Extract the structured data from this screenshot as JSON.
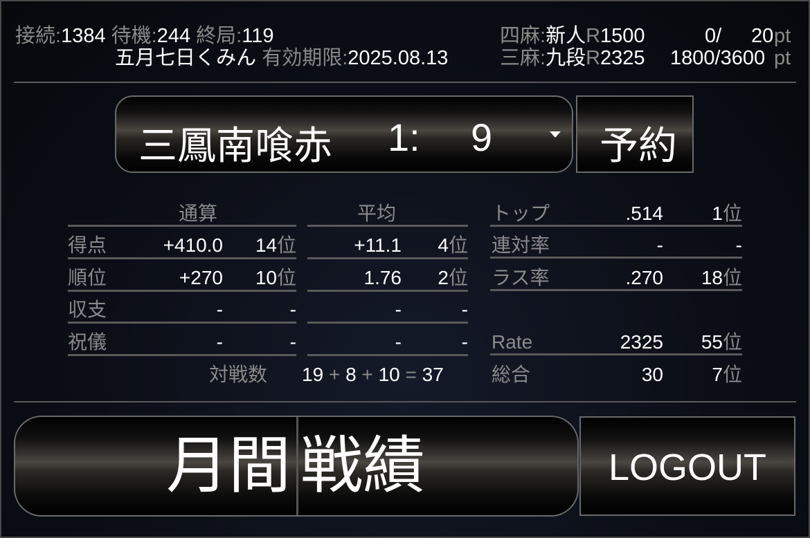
{
  "header": {
    "connect_label": "接続:",
    "connect_value": "1384",
    "wait_label": "待機:",
    "wait_value": "244",
    "end_label": "終局:",
    "end_value": "119",
    "user_name": "五月七日くみん",
    "expire_label": "有効期限:",
    "expire_value": "2025.08.13",
    "four_label": "四麻:",
    "four_rank": "新人",
    "four_r": "R",
    "four_rating": "1500",
    "four_pt_cur": "0/",
    "four_pt_max": "20",
    "four_pt_unit": "pt",
    "three_label": "三麻:",
    "three_rank": "九段",
    "three_r": "R",
    "three_rating": "2325",
    "three_pt": "1800/3600",
    "three_pt_unit": "pt"
  },
  "lobby": {
    "rule": "三鳳南喰赤",
    "time": "1:",
    "time2": "9",
    "reserve_label": "予約"
  },
  "stats": {
    "col_total": "通算",
    "col_avg": "平均",
    "rows": [
      {
        "label": "得点",
        "total": "+410.0",
        "total_rank": "14",
        "avg": "+11.1",
        "avg_rank": "4"
      },
      {
        "label": "順位",
        "total": "+270",
        "total_rank": "10",
        "avg": "1.76",
        "avg_rank": "2"
      },
      {
        "label": "収支",
        "total": "-",
        "total_rank": "-",
        "avg": "-",
        "avg_rank": "-"
      },
      {
        "label": "祝儀",
        "total": "-",
        "total_rank": "-",
        "avg": "-",
        "avg_rank": "-"
      }
    ],
    "rank_suffix": "位",
    "games_label": "対戦数",
    "games": {
      "a": "19",
      "plus1": "+",
      "b": "8",
      "plus2": "+",
      "c": "10",
      "eq": "=",
      "total": "37"
    },
    "right": [
      {
        "label": "トップ",
        "value": ".514",
        "rank": "1"
      },
      {
        "label": "連対率",
        "value": "-",
        "rank": "-"
      },
      {
        "label": "ラス率",
        "value": ".270",
        "rank": "18"
      },
      {
        "label": "Rate",
        "value": "2325",
        "rank": "55"
      },
      {
        "label": "総合",
        "value": "30",
        "rank": "7"
      }
    ]
  },
  "footer": {
    "monthly_left": "月間",
    "monthly_right": "戦績",
    "logout_label": "LOGOUT"
  }
}
